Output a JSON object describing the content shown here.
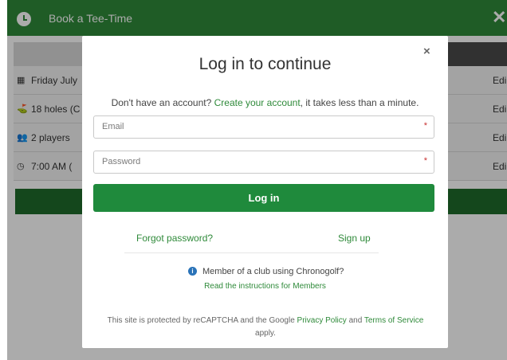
{
  "header": {
    "title": "Book a Tee-Time",
    "close_glyph": "✕",
    "clock_icon": "clock-icon"
  },
  "background_list": {
    "rows": [
      {
        "icon": "calendar-icon",
        "glyph": "▦",
        "text": "Friday July",
        "edit": "Edi"
      },
      {
        "icon": "golfer-icon",
        "glyph": "⛳",
        "text": "18 holes (C",
        "edit": "Edi"
      },
      {
        "icon": "players-icon",
        "glyph": "👥",
        "text": "2 players",
        "edit": "Edi"
      },
      {
        "icon": "clock-icon",
        "glyph": "◷",
        "text": "7:00 AM (",
        "edit": "Edi"
      }
    ]
  },
  "modal": {
    "title": "Log in to continue",
    "close_glyph": "×",
    "no_account_prefix": "Don't have an account? ",
    "create_link": "Create your account",
    "no_account_suffix": ", it takes less than a minute.",
    "email_placeholder": "Email",
    "password_placeholder": "Password",
    "required_marker": "*",
    "login_label": "Log in",
    "forgot_label": "Forgot password?",
    "signup_label": "Sign up",
    "info_glyph": "i",
    "member_text": "Member of a club using Chronogolf?",
    "member_link": "Read the instructions for Members",
    "captcha_prefix": "This site is protected by reCAPTCHA and the Google ",
    "privacy_link": "Privacy Policy",
    "captcha_and": " and ",
    "terms_link": "Terms of Service",
    "captcha_suffix": " apply."
  },
  "colors": {
    "brand_green": "#2f8a3a",
    "button_green": "#1f8a3c",
    "info_blue": "#2a73b8",
    "required_red": "#c83232"
  }
}
